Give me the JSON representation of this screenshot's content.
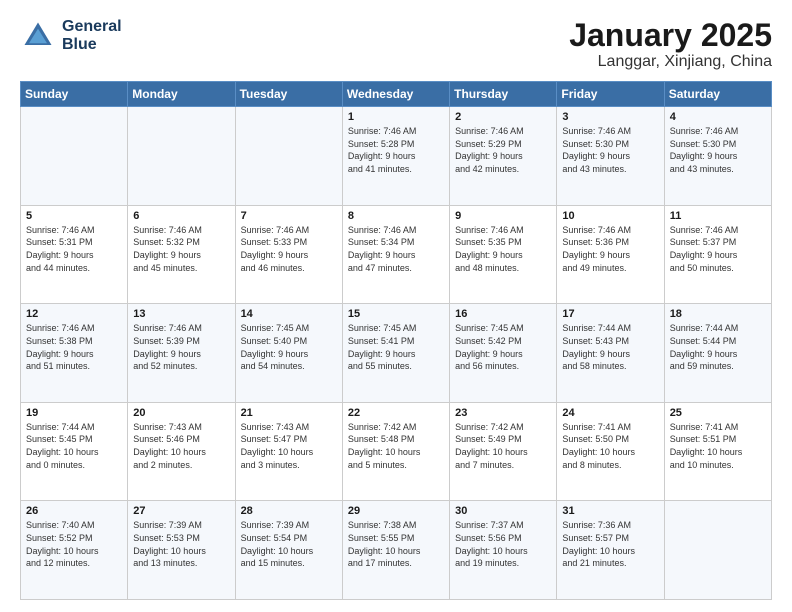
{
  "header": {
    "logo_line1": "General",
    "logo_line2": "Blue",
    "title": "January 2025",
    "subtitle": "Langgar, Xinjiang, China"
  },
  "calendar": {
    "weekdays": [
      "Sunday",
      "Monday",
      "Tuesday",
      "Wednesday",
      "Thursday",
      "Friday",
      "Saturday"
    ],
    "weeks": [
      [
        {
          "day": "",
          "info": ""
        },
        {
          "day": "",
          "info": ""
        },
        {
          "day": "",
          "info": ""
        },
        {
          "day": "1",
          "info": "Sunrise: 7:46 AM\nSunset: 5:28 PM\nDaylight: 9 hours\nand 41 minutes."
        },
        {
          "day": "2",
          "info": "Sunrise: 7:46 AM\nSunset: 5:29 PM\nDaylight: 9 hours\nand 42 minutes."
        },
        {
          "day": "3",
          "info": "Sunrise: 7:46 AM\nSunset: 5:30 PM\nDaylight: 9 hours\nand 43 minutes."
        },
        {
          "day": "4",
          "info": "Sunrise: 7:46 AM\nSunset: 5:30 PM\nDaylight: 9 hours\nand 43 minutes."
        }
      ],
      [
        {
          "day": "5",
          "info": "Sunrise: 7:46 AM\nSunset: 5:31 PM\nDaylight: 9 hours\nand 44 minutes."
        },
        {
          "day": "6",
          "info": "Sunrise: 7:46 AM\nSunset: 5:32 PM\nDaylight: 9 hours\nand 45 minutes."
        },
        {
          "day": "7",
          "info": "Sunrise: 7:46 AM\nSunset: 5:33 PM\nDaylight: 9 hours\nand 46 minutes."
        },
        {
          "day": "8",
          "info": "Sunrise: 7:46 AM\nSunset: 5:34 PM\nDaylight: 9 hours\nand 47 minutes."
        },
        {
          "day": "9",
          "info": "Sunrise: 7:46 AM\nSunset: 5:35 PM\nDaylight: 9 hours\nand 48 minutes."
        },
        {
          "day": "10",
          "info": "Sunrise: 7:46 AM\nSunset: 5:36 PM\nDaylight: 9 hours\nand 49 minutes."
        },
        {
          "day": "11",
          "info": "Sunrise: 7:46 AM\nSunset: 5:37 PM\nDaylight: 9 hours\nand 50 minutes."
        }
      ],
      [
        {
          "day": "12",
          "info": "Sunrise: 7:46 AM\nSunset: 5:38 PM\nDaylight: 9 hours\nand 51 minutes."
        },
        {
          "day": "13",
          "info": "Sunrise: 7:46 AM\nSunset: 5:39 PM\nDaylight: 9 hours\nand 52 minutes."
        },
        {
          "day": "14",
          "info": "Sunrise: 7:45 AM\nSunset: 5:40 PM\nDaylight: 9 hours\nand 54 minutes."
        },
        {
          "day": "15",
          "info": "Sunrise: 7:45 AM\nSunset: 5:41 PM\nDaylight: 9 hours\nand 55 minutes."
        },
        {
          "day": "16",
          "info": "Sunrise: 7:45 AM\nSunset: 5:42 PM\nDaylight: 9 hours\nand 56 minutes."
        },
        {
          "day": "17",
          "info": "Sunrise: 7:44 AM\nSunset: 5:43 PM\nDaylight: 9 hours\nand 58 minutes."
        },
        {
          "day": "18",
          "info": "Sunrise: 7:44 AM\nSunset: 5:44 PM\nDaylight: 9 hours\nand 59 minutes."
        }
      ],
      [
        {
          "day": "19",
          "info": "Sunrise: 7:44 AM\nSunset: 5:45 PM\nDaylight: 10 hours\nand 0 minutes."
        },
        {
          "day": "20",
          "info": "Sunrise: 7:43 AM\nSunset: 5:46 PM\nDaylight: 10 hours\nand 2 minutes."
        },
        {
          "day": "21",
          "info": "Sunrise: 7:43 AM\nSunset: 5:47 PM\nDaylight: 10 hours\nand 3 minutes."
        },
        {
          "day": "22",
          "info": "Sunrise: 7:42 AM\nSunset: 5:48 PM\nDaylight: 10 hours\nand 5 minutes."
        },
        {
          "day": "23",
          "info": "Sunrise: 7:42 AM\nSunset: 5:49 PM\nDaylight: 10 hours\nand 7 minutes."
        },
        {
          "day": "24",
          "info": "Sunrise: 7:41 AM\nSunset: 5:50 PM\nDaylight: 10 hours\nand 8 minutes."
        },
        {
          "day": "25",
          "info": "Sunrise: 7:41 AM\nSunset: 5:51 PM\nDaylight: 10 hours\nand 10 minutes."
        }
      ],
      [
        {
          "day": "26",
          "info": "Sunrise: 7:40 AM\nSunset: 5:52 PM\nDaylight: 10 hours\nand 12 minutes."
        },
        {
          "day": "27",
          "info": "Sunrise: 7:39 AM\nSunset: 5:53 PM\nDaylight: 10 hours\nand 13 minutes."
        },
        {
          "day": "28",
          "info": "Sunrise: 7:39 AM\nSunset: 5:54 PM\nDaylight: 10 hours\nand 15 minutes."
        },
        {
          "day": "29",
          "info": "Sunrise: 7:38 AM\nSunset: 5:55 PM\nDaylight: 10 hours\nand 17 minutes."
        },
        {
          "day": "30",
          "info": "Sunrise: 7:37 AM\nSunset: 5:56 PM\nDaylight: 10 hours\nand 19 minutes."
        },
        {
          "day": "31",
          "info": "Sunrise: 7:36 AM\nSunset: 5:57 PM\nDaylight: 10 hours\nand 21 minutes."
        },
        {
          "day": "",
          "info": ""
        }
      ]
    ]
  }
}
